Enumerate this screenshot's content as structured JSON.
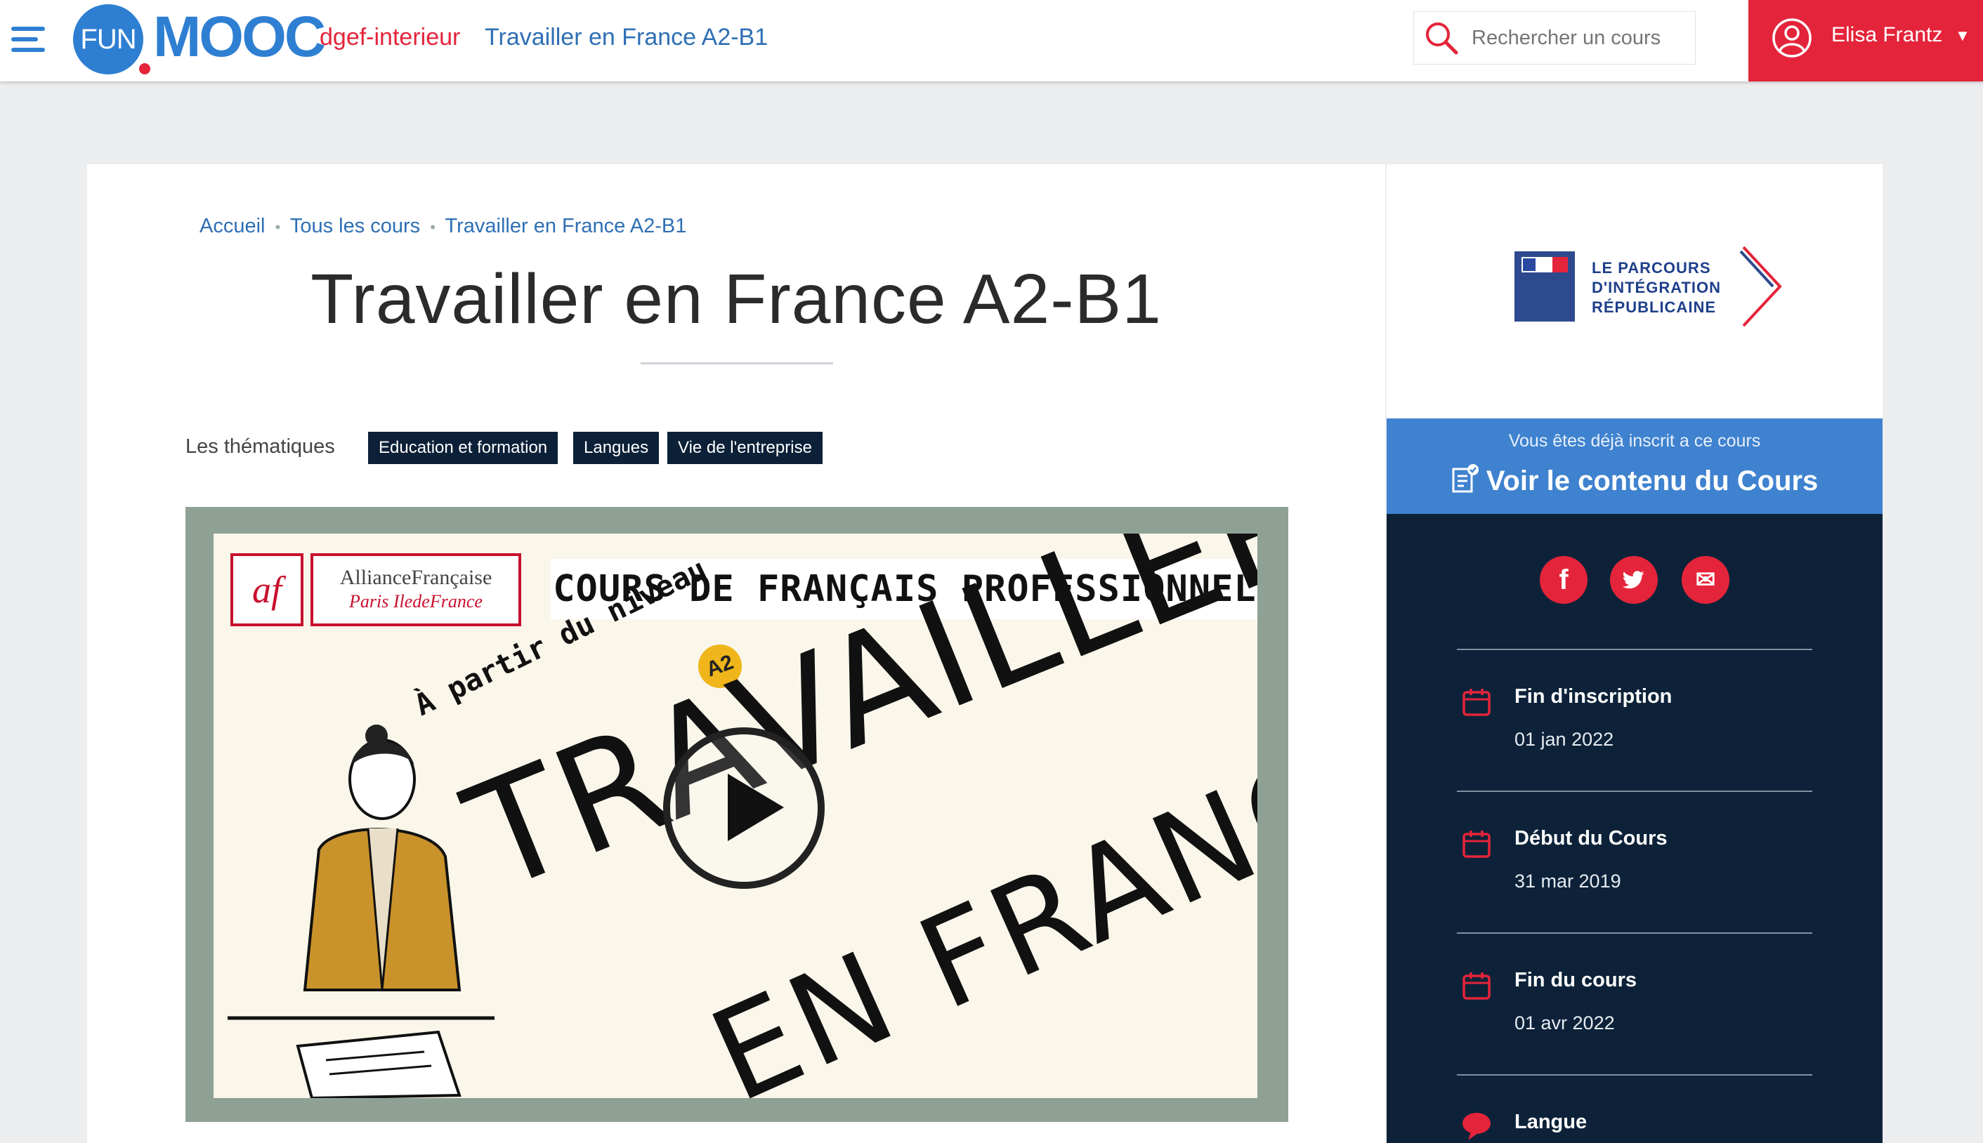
{
  "header": {
    "logo_fun": "FUN",
    "logo_mooc": "MOOC",
    "org": "dgef-interieur",
    "course": "Travailler en France A2-B1",
    "search": {
      "placeholder": "Rechercher un cours"
    },
    "user": {
      "name": "Elisa Frantz",
      "caret": "▼"
    }
  },
  "breadcrumb": {
    "items": [
      "Accueil",
      "Tous les cours",
      "Travailler en France A2-B1"
    ],
    "separator": "•"
  },
  "page": {
    "title": "Travailler en France A2-B1",
    "themes_label": "Les thématiques",
    "themes": [
      "Education et formation",
      "Langues",
      "Vie de l'entreprise"
    ]
  },
  "video": {
    "af_logo_short": "af",
    "af_logo_line1": "AllianceFrançaise",
    "af_logo_line2": "Paris IledeFrance",
    "banner": "COURS DE FRANÇAIS PROFESSIONNEL",
    "level_text": "À partir du niveau",
    "level_badge": "A2",
    "title_line1": "TRAVAILLER",
    "title_line2": "EN FRANCE"
  },
  "sidebar": {
    "partner_logo": {
      "line1": "LE PARCOURS",
      "line2": "D'INTÉGRATION",
      "line3": "RÉPUBLICAINE"
    },
    "enroll_note": "Vous êtes déjà inscrit a ce cours",
    "enroll_link": "Voir le contenu du Cours",
    "social": {
      "facebook": "f",
      "twitter": "t",
      "email": "✉"
    },
    "info": [
      {
        "label": "Fin d'inscription",
        "value": "01 jan 2022",
        "icon": "calendar-icon"
      },
      {
        "label": "Début du Cours",
        "value": "31 mar 2019",
        "icon": "calendar-icon"
      },
      {
        "label": "Fin du cours",
        "value": "01 avr 2022",
        "icon": "calendar-icon"
      },
      {
        "label": "Langue",
        "value": "",
        "icon": "speech-bubble-icon"
      }
    ]
  },
  "colors": {
    "accent_red": "#e4243a",
    "brand_blue": "#2e7fd2",
    "enroll_blue": "#3f82cf",
    "sidebar_navy": "#0d2238",
    "tag_navy": "#0c2038"
  }
}
